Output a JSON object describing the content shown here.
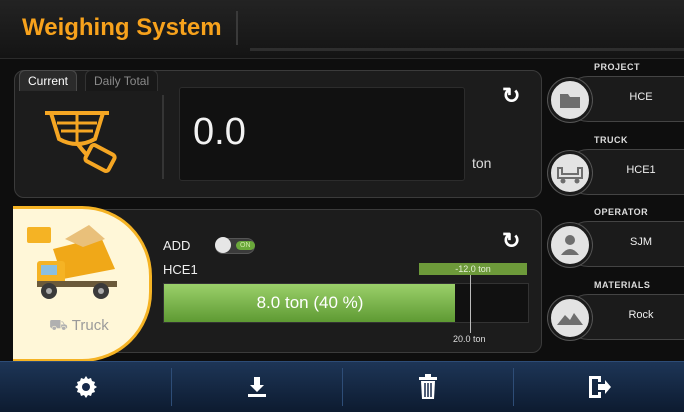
{
  "header": {
    "title": "Weighing System"
  },
  "current_panel": {
    "tabs": [
      {
        "label": "Current"
      },
      {
        "label": "Daily Total"
      }
    ],
    "weight": "0.0",
    "unit": "ton"
  },
  "truck_panel": {
    "truck_label": "Truck",
    "add_label": "ADD",
    "toggle_state_label": "ON",
    "truck_id": "HCE1",
    "offset_label": "-12.0 ton",
    "load_value": "8.0",
    "load_text": "ton (40 %)",
    "load_percent": 40,
    "capacity_label": "20.0 ton"
  },
  "info_cards": [
    {
      "title": "PROJECT",
      "value": "HCE",
      "icon": "folder-icon"
    },
    {
      "title": "TRUCK",
      "value": "HCE1",
      "icon": "truck-icon"
    },
    {
      "title": "OPERATOR",
      "value": "SJM",
      "icon": "operator-icon"
    },
    {
      "title": "MATERIALS",
      "value": "Rock",
      "icon": "materials-icon"
    }
  ],
  "toolbar": {
    "buttons": [
      {
        "icon": "gear-icon"
      },
      {
        "icon": "download-icon"
      },
      {
        "icon": "trash-icon"
      },
      {
        "icon": "exit-icon"
      }
    ]
  },
  "colors": {
    "accent": "#f7a21c",
    "bar": "#7ab84a",
    "toolbar": "#16294a"
  }
}
